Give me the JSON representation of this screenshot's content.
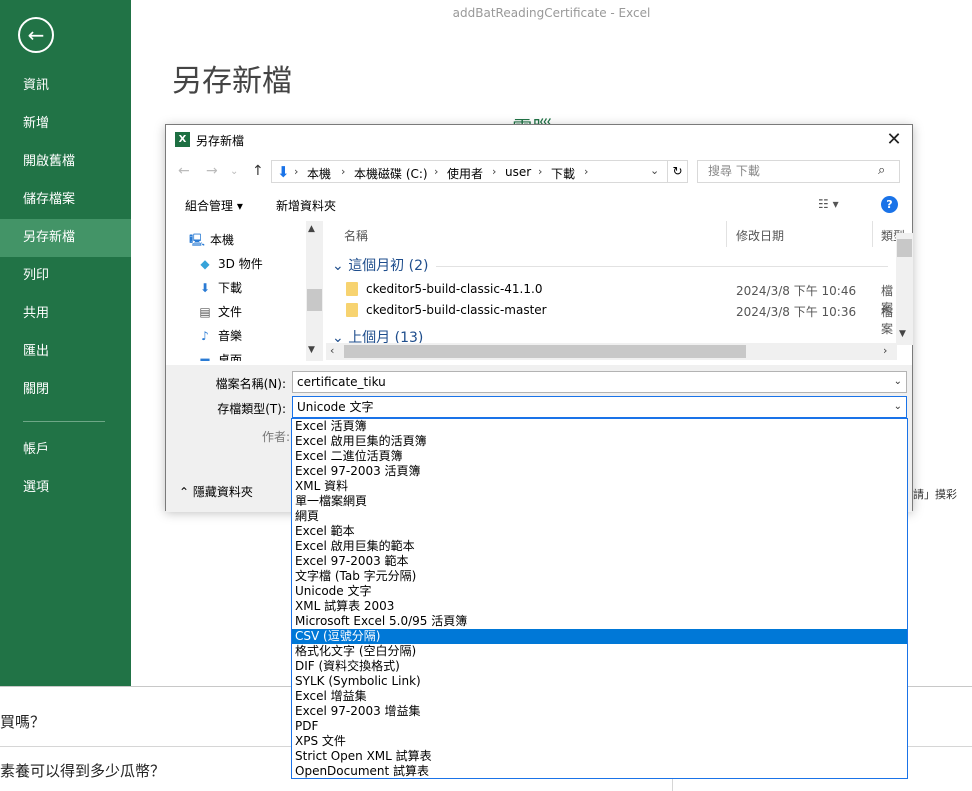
{
  "window": {
    "title": "addBatReadingCertificate - Excel"
  },
  "sidebar": {
    "items": [
      {
        "label": "資訊"
      },
      {
        "label": "新增"
      },
      {
        "label": "開啟舊檔"
      },
      {
        "label": "儲存檔案"
      },
      {
        "label": "另存新檔"
      },
      {
        "label": "列印"
      },
      {
        "label": "共用"
      },
      {
        "label": "匯出"
      },
      {
        "label": "關閉"
      },
      {
        "label": "帳戶"
      },
      {
        "label": "選項"
      }
    ]
  },
  "page": {
    "title": "另存新檔",
    "partial_right": "請」摸彩"
  },
  "dialog": {
    "title": "另存新檔",
    "breadcrumb": [
      "本機",
      "本機磁碟 (C:)",
      "使用者",
      "user",
      "下載"
    ],
    "search_placeholder": "搜尋 下載",
    "toolbar": {
      "organize": "組合管理 ▾",
      "new_folder": "新增資料夾"
    },
    "tree": [
      {
        "label": "本機",
        "icon": "pc-icon"
      },
      {
        "label": "3D 物件",
        "icon": "cube-icon"
      },
      {
        "label": "下載",
        "icon": "download-icon"
      },
      {
        "label": "文件",
        "icon": "document-icon"
      },
      {
        "label": "音樂",
        "icon": "music-icon"
      },
      {
        "label": "桌面",
        "icon": "desktop-icon"
      }
    ],
    "columns": {
      "name": "名稱",
      "date": "修改日期",
      "type": "類型"
    },
    "groups": [
      {
        "label": "這個月初 (2)"
      },
      {
        "label": "上個月 (13)"
      }
    ],
    "files": [
      {
        "name": "ckeditor5-build-classic-41.1.0",
        "date": "2024/3/8 下午 10:46",
        "type": "檔案"
      },
      {
        "name": "ckeditor5-build-classic-master",
        "date": "2024/3/8 下午 10:36",
        "type": "檔案"
      }
    ],
    "form": {
      "filename_label": "檔案名稱(N):",
      "filename_value": "certificate_tiku",
      "filetype_label": "存檔類型(T):",
      "filetype_value": "Unicode 文字",
      "author_label": "作者:",
      "hide_folders": "隱藏資料夾"
    },
    "filetype_options": [
      "Excel 活頁簿",
      "Excel 啟用巨集的活頁簿",
      "Excel 二進位活頁簿",
      "Excel 97-2003 活頁簿",
      "XML 資料",
      "單一檔案網頁",
      "網頁",
      "Excel 範本",
      "Excel 啟用巨集的範本",
      "Excel 97-2003 範本",
      "文字檔 (Tab 字元分隔)",
      "Unicode 文字",
      "XML 試算表 2003",
      "Microsoft Excel 5.0/95 活頁簿",
      "CSV (逗號分隔)",
      "格式化文字 (空白分隔)",
      "DIF (資料交換格式)",
      "SYLK (Symbolic Link)",
      "Excel 增益集",
      "Excel 97-2003 增益集",
      "PDF",
      "XPS 文件",
      "Strict Open XML 試算表",
      "OpenDocument 試算表"
    ],
    "selected_option": "CSV (逗號分隔)"
  },
  "bottom": {
    "q1": "買嗎？",
    "q2": "素養可以得到多少瓜幣？"
  },
  "colors": {
    "sidebar": "#217346",
    "sidebar_active": "#439467",
    "selection": "#0078d7"
  }
}
